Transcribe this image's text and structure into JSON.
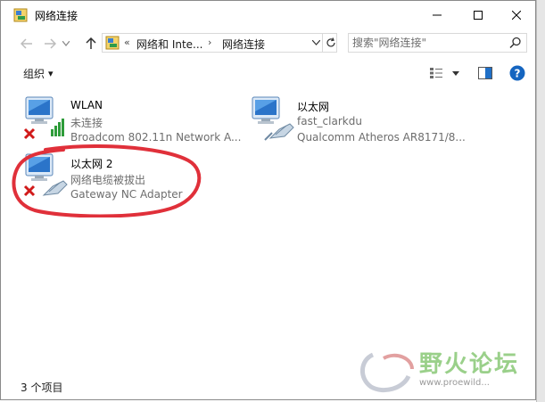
{
  "window": {
    "title": "网络连接"
  },
  "nav": {
    "breadcrumb_prefix": "«",
    "breadcrumb_parent": "网络和 Inte...",
    "breadcrumb_separator": "›",
    "breadcrumb_current": "网络连接",
    "search_placeholder": "搜索\"网络连接\""
  },
  "command_bar": {
    "organize_label": "组织",
    "organize_arrow": "▾"
  },
  "connections": [
    {
      "name": "WLAN",
      "status": "未连接",
      "device": "Broadcom 802.11n Network A...",
      "type": "wireless",
      "disconnected": true
    },
    {
      "name": "以太网",
      "status": "fast_clarkdu",
      "device": "Qualcomm Atheros AR8171/8...",
      "type": "ethernet",
      "disconnected": false
    },
    {
      "name": "以太网 2",
      "status": "网络电缆被拔出",
      "device": "Gateway NC Adapter",
      "type": "ethernet",
      "disconnected": true
    }
  ],
  "status_bar": {
    "item_count": "3 个项目"
  },
  "watermark": {
    "text": "野火论坛",
    "url": "www.proewild..."
  },
  "colors": {
    "accent": "#0078d7",
    "annotation": "#e0303a",
    "error": "#d11a1a"
  }
}
